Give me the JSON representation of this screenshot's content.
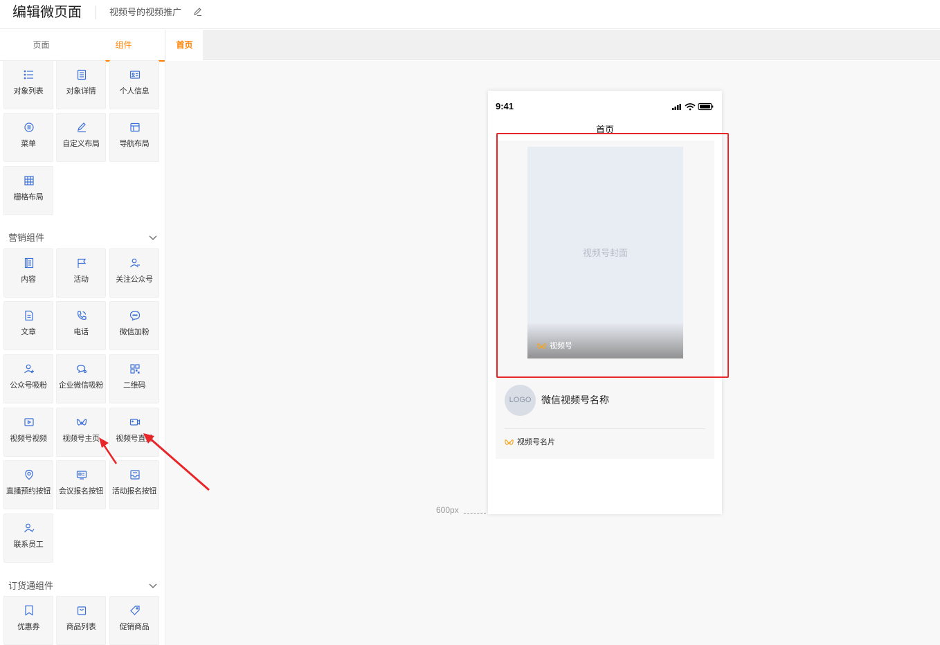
{
  "header": {
    "title": "编辑微页面",
    "page_name": "视频号的视频推广"
  },
  "left_tabs": [
    "页面",
    "组件"
  ],
  "basic_components": [
    {
      "label": "对象列表",
      "icon": "list-icon"
    },
    {
      "label": "对象详情",
      "icon": "detail-icon"
    },
    {
      "label": "个人信息",
      "icon": "id-card-icon"
    },
    {
      "label": "菜单",
      "icon": "menu-icon"
    },
    {
      "label": "自定义布局",
      "icon": "pen-icon"
    },
    {
      "label": "导航布局",
      "icon": "nav-layout-icon"
    },
    {
      "label": "栅格布局",
      "icon": "grid-icon"
    }
  ],
  "marketing": {
    "title": "营销组件",
    "items": [
      {
        "label": "内容",
        "icon": "book-icon"
      },
      {
        "label": "活动",
        "icon": "flag-icon"
      },
      {
        "label": "关注公众号",
        "icon": "user-follow-icon"
      },
      {
        "label": "文章",
        "icon": "article-icon"
      },
      {
        "label": "电话",
        "icon": "phone-icon"
      },
      {
        "label": "微信加粉",
        "icon": "chat-icon"
      },
      {
        "label": "公众号吸粉",
        "icon": "user-plus-icon"
      },
      {
        "label": "企业微信吸粉",
        "icon": "wecom-icon"
      },
      {
        "label": "二维码",
        "icon": "qrcode-icon"
      },
      {
        "label": "视频号视频",
        "icon": "video-icon"
      },
      {
        "label": "视频号主页",
        "icon": "channels-icon"
      },
      {
        "label": "视频号直播",
        "icon": "live-icon"
      },
      {
        "label": "直播预约按钮",
        "icon": "reserve-icon"
      },
      {
        "label": "会议报名按钮",
        "icon": "meeting-icon"
      },
      {
        "label": "活动报名按钮",
        "icon": "inbox-icon"
      },
      {
        "label": "联系员工",
        "icon": "contact-icon"
      }
    ]
  },
  "ordering": {
    "title": "订货通组件",
    "items": [
      {
        "label": "优惠券",
        "icon": "coupon-icon"
      },
      {
        "label": "商品列表",
        "icon": "shop-bag-icon"
      },
      {
        "label": "促销商品",
        "icon": "tag-icon"
      }
    ]
  },
  "canvas": {
    "tab": "首页",
    "width_label": "600px"
  },
  "phone": {
    "time": "9:41",
    "title": "首页",
    "cover_label": "视频号封面",
    "badge_label": "视频号",
    "logo_text": "LOGO",
    "account_name": "微信视频号名称",
    "card_label": "视频号名片"
  },
  "colors": {
    "accent": "#ff8000",
    "highlight": "#e8262a",
    "icon_blue": "#3a6fd8"
  }
}
